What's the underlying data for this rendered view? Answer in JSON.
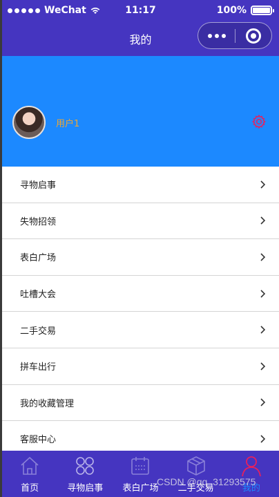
{
  "status_bar": {
    "carrier": "WeChat",
    "time": "11:17",
    "battery": "100%"
  },
  "nav": {
    "title": "我的"
  },
  "profile": {
    "username": "用户1"
  },
  "menu": [
    {
      "label": "寻物启事"
    },
    {
      "label": "失物招领"
    },
    {
      "label": "表白广场"
    },
    {
      "label": "吐槽大会"
    },
    {
      "label": "二手交易"
    },
    {
      "label": "拼车出行"
    },
    {
      "label": "我的收藏管理"
    },
    {
      "label": "客服中心"
    }
  ],
  "tabbar": [
    {
      "label": "首页",
      "icon": "home-icon"
    },
    {
      "label": "寻物启事",
      "icon": "clover-icon"
    },
    {
      "label": "表白广场",
      "icon": "calendar-icon"
    },
    {
      "label": "二手交易",
      "icon": "box-icon"
    },
    {
      "label": "我的",
      "icon": "user-icon"
    }
  ],
  "watermark": "CSDN @qq_31293575",
  "colors": {
    "header": "#4535c0",
    "profile_bg": "#1c89ff",
    "username": "#f0a630",
    "settings": "#e6205e",
    "tab_active": "#e6205e"
  }
}
